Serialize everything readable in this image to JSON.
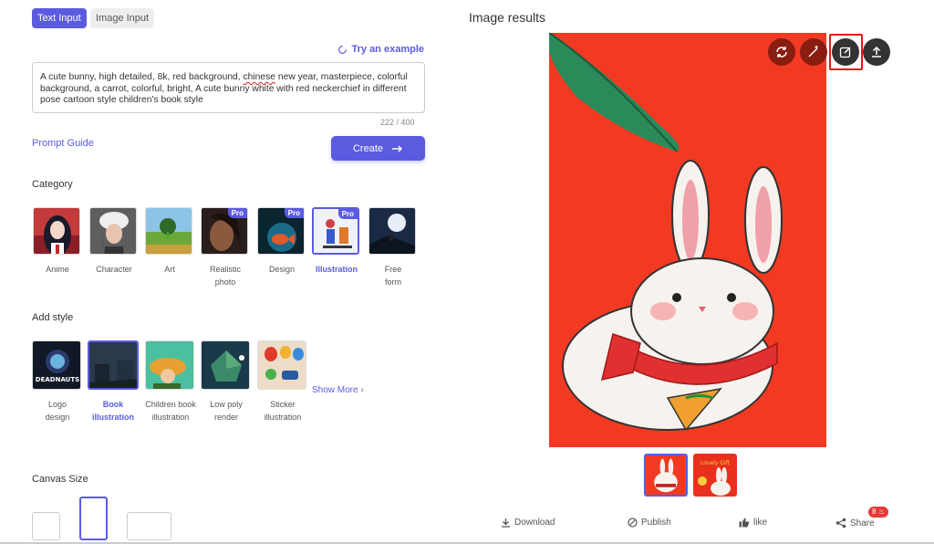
{
  "tabs": {
    "text_input": "Text Input",
    "image_input": "Image Input"
  },
  "prompt": {
    "try_example": "Try an example",
    "text_part1": "A cute bunny, high detailed, 8k, red background, ",
    "text_misspelled": "chinese",
    "text_part2": " new year, masterpiece, colorful background, a carrot, colorful, bright, A cute bunny white with red neckerchief in different pose cartoon style children's book style",
    "counter": "222 / 400",
    "guide": "Prompt Guide",
    "create": "Create"
  },
  "category": {
    "title": "Category",
    "items": [
      {
        "label": "Anime",
        "pro": ""
      },
      {
        "label": "Character",
        "pro": ""
      },
      {
        "label": "Art",
        "pro": ""
      },
      {
        "label": "Realistic photo",
        "pro": "Pro"
      },
      {
        "label": "Design",
        "pro": "Pro"
      },
      {
        "label": "Illustration",
        "pro": "Pro"
      },
      {
        "label": "Free form",
        "pro": ""
      }
    ]
  },
  "style": {
    "title": "Add style",
    "items": [
      {
        "label": "Logo design",
        "thumb_text": "DEADNAUTS"
      },
      {
        "label": "Book illustration"
      },
      {
        "label": "Children book illustration"
      },
      {
        "label": "Low poly render"
      },
      {
        "label": "Sticker illustration"
      }
    ],
    "show_more": "Show More"
  },
  "canvas": {
    "title": "Canvas Size"
  },
  "results": {
    "title": "Image results",
    "thumb2_text": "Lovely Gift",
    "actions": [
      "refresh-icon",
      "magic-wand-icon",
      "edit-icon",
      "upload-icon"
    ]
  },
  "footer": {
    "download": "Download",
    "publish": "Publish",
    "like": "like",
    "share": "Share",
    "share_count": "8"
  },
  "colors": {
    "accent": "#5b5be0",
    "image_bg": "#f23a22",
    "highlight": "#e01a1a"
  }
}
